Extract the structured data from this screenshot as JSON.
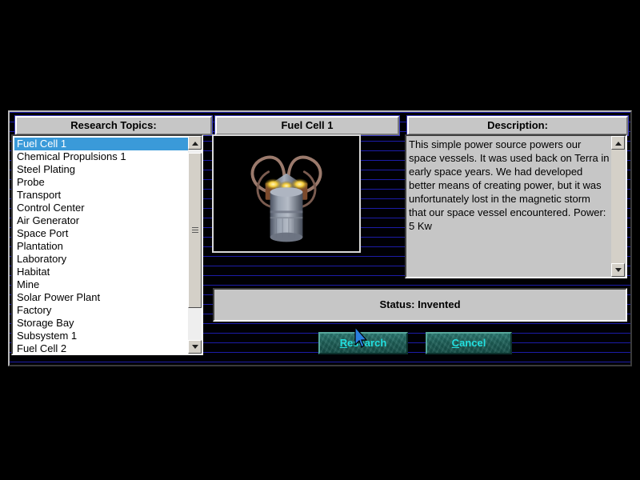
{
  "window": {
    "background_color": "#000000",
    "dialog_bg": "#000006",
    "scanline_color": "#1c1ca8",
    "panel_face": "#c6c6c6",
    "select_color": "#3a9ad9",
    "button_text_color": "#23e0e0"
  },
  "headers": {
    "topics": "Research Topics:",
    "item_title": "Fuel Cell 1",
    "description": "Description:"
  },
  "topics": {
    "items": [
      {
        "label": "Fuel Cell 1",
        "selected": true
      },
      {
        "label": "Chemical Propulsions 1",
        "selected": false
      },
      {
        "label": "Steel Plating",
        "selected": false
      },
      {
        "label": "Probe",
        "selected": false
      },
      {
        "label": "Transport",
        "selected": false
      },
      {
        "label": "Control Center",
        "selected": false
      },
      {
        "label": "Air Generator",
        "selected": false
      },
      {
        "label": "Space Port",
        "selected": false
      },
      {
        "label": "Plantation",
        "selected": false
      },
      {
        "label": "Laboratory",
        "selected": false
      },
      {
        "label": "Habitat",
        "selected": false
      },
      {
        "label": "Mine",
        "selected": false
      },
      {
        "label": "Solar Power Plant",
        "selected": false
      },
      {
        "label": "Factory",
        "selected": false
      },
      {
        "label": "Storage Bay",
        "selected": false
      },
      {
        "label": "Subsystem 1",
        "selected": false
      },
      {
        "label": "Fuel Cell 2",
        "selected": false
      }
    ]
  },
  "description": {
    "body": "This simple power source powers our space vessels.  It was used back on Terra in early space years. We had developed better means of creating power, but it was unfortunately lost in the magnetic storm that our space vessel encountered.  Power: 5 Kw"
  },
  "status": {
    "text": "Status: Invented"
  },
  "buttons": {
    "research": {
      "accel": "R",
      "rest": "esearch"
    },
    "cancel": {
      "accel": "C",
      "rest": "ancel"
    }
  },
  "icons": {
    "scroll_up": "scroll-up-arrow-icon",
    "scroll_down": "scroll-down-arrow-icon",
    "artwork": "fuel-cell-render-icon",
    "cursor": "mouse-pointer-icon"
  }
}
